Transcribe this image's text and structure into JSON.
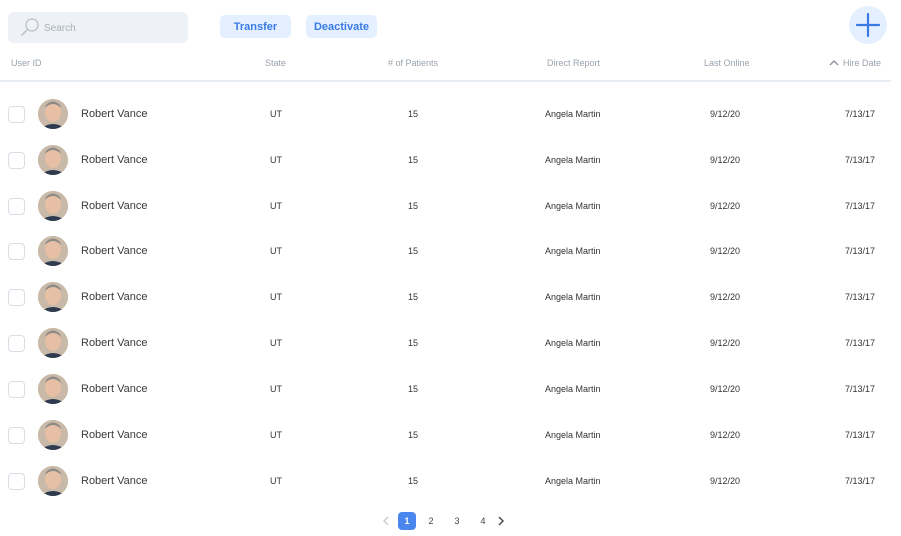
{
  "toolbar": {
    "search_placeholder": "Search",
    "search_icon": "search-icon",
    "transfer_label": "Transfer",
    "deactivate_label": "Deactivate",
    "add_icon": "plus-icon"
  },
  "table": {
    "columns": {
      "user_id": "User ID",
      "state": "State",
      "patients": "# of Patients",
      "direct_report": "Direct Report",
      "last_online": "Last Online",
      "hire_date": "Hire Date"
    },
    "sort": {
      "column": "hire_date",
      "direction": "ascending-icon"
    },
    "rows": [
      {
        "name": "Robert Vance",
        "state": "UT",
        "patients": "15",
        "report": "Angela Martin",
        "last": "9/12/20",
        "hire": "7/13/17"
      },
      {
        "name": "Robert Vance",
        "state": "UT",
        "patients": "15",
        "report": "Angela Martin",
        "last": "9/12/20",
        "hire": "7/13/17"
      },
      {
        "name": "Robert Vance",
        "state": "UT",
        "patients": "15",
        "report": "Angela Martin",
        "last": "9/12/20",
        "hire": "7/13/17"
      },
      {
        "name": "Robert Vance",
        "state": "UT",
        "patients": "15",
        "report": "Angela Martin",
        "last": "9/12/20",
        "hire": "7/13/17"
      },
      {
        "name": "Robert Vance",
        "state": "UT",
        "patients": "15",
        "report": "Angela Martin",
        "last": "9/12/20",
        "hire": "7/13/17"
      },
      {
        "name": "Robert Vance",
        "state": "UT",
        "patients": "15",
        "report": "Angela Martin",
        "last": "9/12/20",
        "hire": "7/13/17"
      },
      {
        "name": "Robert Vance",
        "state": "UT",
        "patients": "15",
        "report": "Angela Martin",
        "last": "9/12/20",
        "hire": "7/13/17"
      },
      {
        "name": "Robert Vance",
        "state": "UT",
        "patients": "15",
        "report": "Angela Martin",
        "last": "9/12/20",
        "hire": "7/13/17"
      },
      {
        "name": "Robert Vance",
        "state": "UT",
        "patients": "15",
        "report": "Angela Martin",
        "last": "9/12/20",
        "hire": "7/13/17"
      }
    ]
  },
  "pagination": {
    "pages": [
      "1",
      "2",
      "3",
      "4"
    ],
    "current": "1"
  },
  "colors": {
    "accent": "#4a86ee",
    "pill_bg": "#e4efff",
    "pill_text": "#3a7ae6",
    "search_bg": "#eef1f5"
  }
}
